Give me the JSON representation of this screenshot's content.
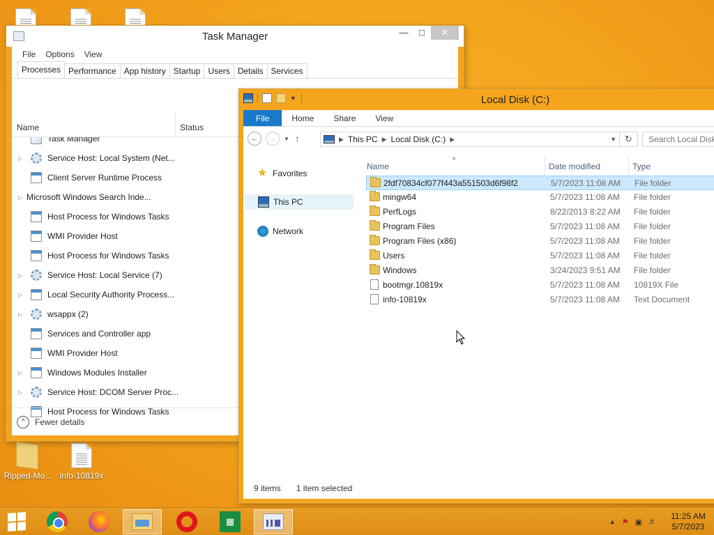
{
  "desktop": {
    "icons": [
      {
        "label": "Ripped-Mo..."
      },
      {
        "label": "info-10819x"
      }
    ]
  },
  "taskmgr": {
    "title": "Task Manager",
    "menu": [
      "File",
      "Options",
      "View"
    ],
    "tabs": [
      "Processes",
      "Performance",
      "App history",
      "Startup",
      "Users",
      "Details",
      "Services"
    ],
    "active_tab": "Processes",
    "columns": {
      "name": "Name",
      "status": "Status"
    },
    "processes": [
      {
        "name": "Task Manager",
        "expandable": false,
        "icon": "tm-icon"
      },
      {
        "name": "Service Host: Local System (Net...",
        "expandable": true,
        "icon": "gear-icon"
      },
      {
        "name": "Client Server Runtime Process",
        "expandable": false,
        "icon": "app-icon"
      },
      {
        "name": "Microsoft Windows Search Inde...",
        "expandable": true,
        "icon": "search-user-icon"
      },
      {
        "name": "Host Process for Windows Tasks",
        "expandable": false,
        "icon": "app-icon"
      },
      {
        "name": "WMI Provider Host",
        "expandable": false,
        "icon": "app-icon"
      },
      {
        "name": "Host Process for Windows Tasks",
        "expandable": false,
        "icon": "app-icon"
      },
      {
        "name": "Service Host: Local Service (7)",
        "expandable": true,
        "icon": "gear-icon"
      },
      {
        "name": "Local Security Authority Process...",
        "expandable": true,
        "icon": "app-icon"
      },
      {
        "name": "wsappx (2)",
        "expandable": true,
        "icon": "gear-icon"
      },
      {
        "name": "Services and Controller app",
        "expandable": false,
        "icon": "app-icon"
      },
      {
        "name": "WMI Provider Host",
        "expandable": false,
        "icon": "app-icon"
      },
      {
        "name": "Windows Modules Installer",
        "expandable": true,
        "icon": "app-icon"
      },
      {
        "name": "Service Host: DCOM Server Proc...",
        "expandable": true,
        "icon": "gear-icon"
      },
      {
        "name": "Host Process for Windows Tasks",
        "expandable": false,
        "icon": "app-icon"
      }
    ],
    "fewer_details": "Fewer details"
  },
  "explorer": {
    "title": "Local Disk (C:)",
    "ribbon_tabs": [
      "File",
      "Home",
      "Share",
      "View"
    ],
    "breadcrumb": [
      "This PC",
      "Local Disk (C:)"
    ],
    "search_placeholder": "Search Local Disk",
    "nav": [
      {
        "label": "Favorites",
        "icon": "star-icon",
        "selected": false
      },
      {
        "label": "This PC",
        "icon": "computer-icon",
        "selected": true
      },
      {
        "label": "Network",
        "icon": "network-icon",
        "selected": false
      }
    ],
    "columns": {
      "name": "Name",
      "date": "Date modified",
      "type": "Type"
    },
    "files": [
      {
        "name": "2fdf70834cf077f443a551503d6f98f2",
        "date": "5/7/2023 11:08 AM",
        "type": "File folder",
        "kind": "folder",
        "selected": true
      },
      {
        "name": "mingw64",
        "date": "5/7/2023 11:08 AM",
        "type": "File folder",
        "kind": "folder",
        "selected": false
      },
      {
        "name": "PerfLogs",
        "date": "8/22/2013 8:22 AM",
        "type": "File folder",
        "kind": "folder",
        "selected": false
      },
      {
        "name": "Program Files",
        "date": "5/7/2023 11:08 AM",
        "type": "File folder",
        "kind": "folder",
        "selected": false
      },
      {
        "name": "Program Files (x86)",
        "date": "5/7/2023 11:08 AM",
        "type": "File folder",
        "kind": "folder",
        "selected": false
      },
      {
        "name": "Users",
        "date": "5/7/2023 11:08 AM",
        "type": "File folder",
        "kind": "folder",
        "selected": false
      },
      {
        "name": "Windows",
        "date": "3/24/2023 9:51 AM",
        "type": "File folder",
        "kind": "folder",
        "selected": false
      },
      {
        "name": "bootmgr.10819x",
        "date": "5/7/2023 11:08 AM",
        "type": "10819X File",
        "kind": "file",
        "selected": false
      },
      {
        "name": "info-10819x",
        "date": "5/7/2023 11:08 AM",
        "type": "Text Document",
        "kind": "file",
        "selected": false
      }
    ],
    "status": {
      "items": "9 items",
      "selected": "1 item selected"
    }
  },
  "taskbar": {
    "apps": [
      "start-icon",
      "chrome-icon",
      "firefox-icon",
      "file-explorer-icon",
      "opera-icon",
      "store-icon",
      "task-manager-icon"
    ],
    "clock": {
      "time": "11:25 AM",
      "date": "5/7/2023"
    }
  }
}
